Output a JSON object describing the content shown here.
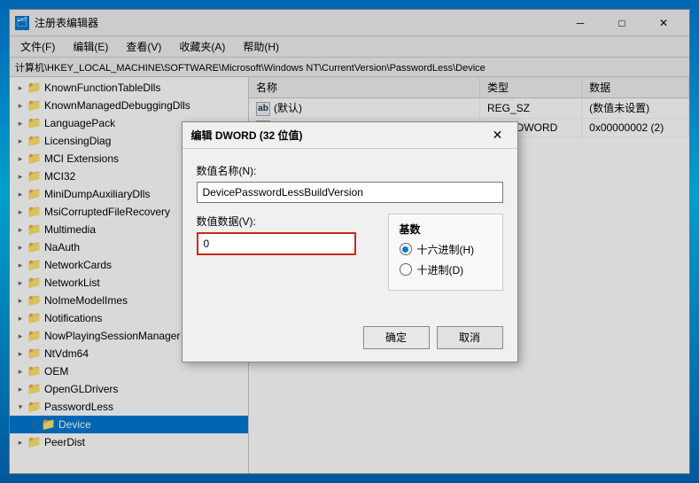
{
  "window": {
    "title": "注册表编辑器",
    "icon": "🗂"
  },
  "menu": {
    "items": [
      "文件(F)",
      "编辑(E)",
      "查看(V)",
      "收藏夹(A)",
      "帮助(H)"
    ]
  },
  "address": {
    "label": "计算机\\HKEY_LOCAL_MACHINE\\SOFTWARE\\Microsoft\\Windows NT\\CurrentVersion\\PasswordLess\\Device"
  },
  "tree": {
    "items": [
      {
        "id": "KnownFunctionTableDlls",
        "label": "KnownFunctionTableDlls",
        "indent": 0,
        "expanded": false,
        "selected": false
      },
      {
        "id": "KnownManagedDebuggingDlls",
        "label": "KnownManagedDebuggingDlls",
        "indent": 0,
        "expanded": false,
        "selected": false
      },
      {
        "id": "LanguagePack",
        "label": "LanguagePack",
        "indent": 0,
        "expanded": false,
        "selected": false
      },
      {
        "id": "LicensingDiag",
        "label": "LicensingDiag",
        "indent": 0,
        "expanded": false,
        "selected": false
      },
      {
        "id": "MCI Extensions",
        "label": "MCI Extensions",
        "indent": 0,
        "expanded": false,
        "selected": false
      },
      {
        "id": "MCI32",
        "label": "MCI32",
        "indent": 0,
        "expanded": false,
        "selected": false
      },
      {
        "id": "MiniDumpAuxiliaryDlls",
        "label": "MiniDumpAuxiliaryDlls",
        "indent": 0,
        "expanded": false,
        "selected": false
      },
      {
        "id": "MsiCorruptedFileRecovery",
        "label": "MsiCorruptedFileRecovery",
        "indent": 0,
        "expanded": false,
        "selected": false
      },
      {
        "id": "Multimedia",
        "label": "Multimedia",
        "indent": 0,
        "expanded": false,
        "selected": false
      },
      {
        "id": "NaAuth",
        "label": "NaAuth",
        "indent": 0,
        "expanded": false,
        "selected": false
      },
      {
        "id": "NetworkCards",
        "label": "NetworkCards",
        "indent": 0,
        "expanded": false,
        "selected": false
      },
      {
        "id": "NetworkList",
        "label": "NetworkList",
        "indent": 0,
        "expanded": false,
        "selected": false
      },
      {
        "id": "NoImeModelImes",
        "label": "NoImeModelImes",
        "indent": 0,
        "expanded": false,
        "selected": false
      },
      {
        "id": "Notifications",
        "label": "Notifications",
        "indent": 0,
        "expanded": false,
        "selected": false
      },
      {
        "id": "NowPlayingSessionManager",
        "label": "NowPlayingSessionManager",
        "indent": 0,
        "expanded": false,
        "selected": false
      },
      {
        "id": "NtVdm64",
        "label": "NtVdm64",
        "indent": 0,
        "expanded": false,
        "selected": false
      },
      {
        "id": "OEM",
        "label": "OEM",
        "indent": 0,
        "expanded": false,
        "selected": false
      },
      {
        "id": "OpenGLDrivers",
        "label": "OpenGLDrivers",
        "indent": 0,
        "expanded": false,
        "selected": false
      },
      {
        "id": "PasswordLess",
        "label": "PasswordLess",
        "indent": 0,
        "expanded": true,
        "selected": false
      },
      {
        "id": "Device",
        "label": "Device",
        "indent": 1,
        "expanded": false,
        "selected": true
      },
      {
        "id": "PeerDist",
        "label": "PeerDist",
        "indent": 0,
        "expanded": false,
        "selected": false
      }
    ]
  },
  "registry_table": {
    "headers": [
      "名称",
      "类型",
      "数据"
    ],
    "rows": [
      {
        "name": "(默认)",
        "type": "REG_SZ",
        "data": "(数值未设置)",
        "icon": "ab"
      },
      {
        "name": "DevicePasswordLessBuildVersion",
        "type": "REG_DWORD",
        "data": "0x00000002 (2)",
        "icon": "img"
      }
    ]
  },
  "dialog": {
    "title": "编辑 DWORD (32 位值)",
    "close_btn": "✕",
    "value_name_label": "数值名称(N):",
    "value_name": "DevicePasswordLessBuildVersion",
    "value_data_label": "数值数据(V):",
    "value_data": "0",
    "radix": {
      "title": "基数",
      "options": [
        {
          "label": "十六进制(H)",
          "value": "hex",
          "checked": true
        },
        {
          "label": "十进制(D)",
          "value": "dec",
          "checked": false
        }
      ]
    },
    "ok_label": "确定",
    "cancel_label": "取消"
  }
}
